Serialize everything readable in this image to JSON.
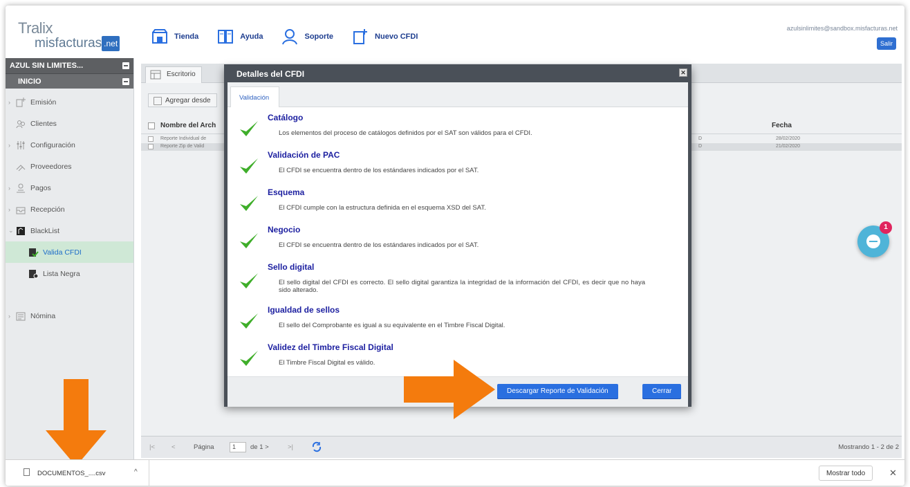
{
  "header": {
    "logo_line1": "Tralix",
    "logo_line2": "misfacturas",
    "logo_badge": ".net",
    "nav": [
      {
        "label": "Tienda",
        "icon": "store-icon"
      },
      {
        "label": "Ayuda",
        "icon": "book-icon"
      },
      {
        "label": "Soporte",
        "icon": "support-icon"
      },
      {
        "label": "Nuevo CFDI",
        "icon": "new-document-icon"
      }
    ],
    "user_email": "azulsinlimites@sandbox.misfacturas.net",
    "logout_label": "Salir"
  },
  "sidebar": {
    "company": "AZUL SIN LIMITES...",
    "section": "INICIO",
    "items": [
      {
        "label": "Emisión",
        "icon": "emission-icon",
        "expandable": true
      },
      {
        "label": "Clientes",
        "icon": "clients-icon",
        "expandable": false
      },
      {
        "label": "Configuración",
        "icon": "settings-icon",
        "expandable": true
      },
      {
        "label": "Proveedores",
        "icon": "suppliers-icon",
        "expandable": false
      },
      {
        "label": "Pagos",
        "icon": "payments-icon",
        "expandable": true
      },
      {
        "label": "Recepción",
        "icon": "inbox-icon",
        "expandable": true
      },
      {
        "label": "BlackList",
        "icon": "blacklist-icon",
        "expandable": true
      },
      {
        "label": "Valida CFDI",
        "icon": "validate-icon",
        "sub": true,
        "active": true
      },
      {
        "label": "Lista Negra",
        "icon": "blacklist-doc-icon",
        "sub": true
      },
      {
        "label": "Nómina",
        "icon": "payroll-icon",
        "expandable": true
      }
    ]
  },
  "main": {
    "tab_label": "Escritorio",
    "toolbar_button": "Agregar desde",
    "grid": {
      "col_name": "Nombre del Arch",
      "col_date": "Fecha",
      "rows": [
        {
          "name": "Reporte Individual de",
          "col": "D",
          "date": "28/02/2020"
        },
        {
          "name": "Reporte Zip de Valid",
          "col": "D",
          "date": "21/02/2020"
        }
      ]
    },
    "pager": {
      "first": "|<",
      "prev": "<",
      "page_label": "Página",
      "page_value": "1",
      "of_label": "de 1 >",
      "last": ">|",
      "info": "Mostrando 1 - 2 de 2"
    }
  },
  "chat": {
    "badge": "1"
  },
  "modal": {
    "title": "Detalles del CFDI",
    "close_glyph": "✕",
    "tab": "Validación",
    "items": [
      {
        "title": "Catálogo",
        "desc": "Los elementos del proceso de catálogos definidos por el SAT son válidos para el CFDI."
      },
      {
        "title": "Validación de PAC",
        "desc": "El CFDI se encuentra dentro de los estándares indicados por el SAT."
      },
      {
        "title": "Esquema",
        "desc": "El CFDI cumple con la estructura definida en el esquema XSD del SAT."
      },
      {
        "title": "Negocio",
        "desc": "El CFDI se encuentra dentro de los estándares indicados por el SAT."
      },
      {
        "title": "Sello digital",
        "desc": "El sello digital del CFDI es correcto. El sello digital garantiza la integridad de la información del CFDI, es decir que no haya sido alterado."
      },
      {
        "title": "Igualdad de sellos",
        "desc": "El sello del Comprobante es igual a su equivalente en el Timbre Fiscal Digital."
      },
      {
        "title": "Validez del Timbre Fiscal Digital",
        "desc": "El Timbre Fiscal Digital es válido."
      }
    ],
    "report_button": "Descargar Reporte de Validación",
    "close_button": "Cerrar"
  },
  "downloads": {
    "file_name": "DOCUMENTOS_....csv",
    "chevron": "^",
    "show_all": "Mostrar todo",
    "close_glyph": "✕"
  },
  "colors": {
    "accent_blue": "#2a6fe0",
    "arrow_orange": "#f47b0d",
    "check_green": "#3fae2a",
    "title_navy": "#1c1fa0"
  }
}
